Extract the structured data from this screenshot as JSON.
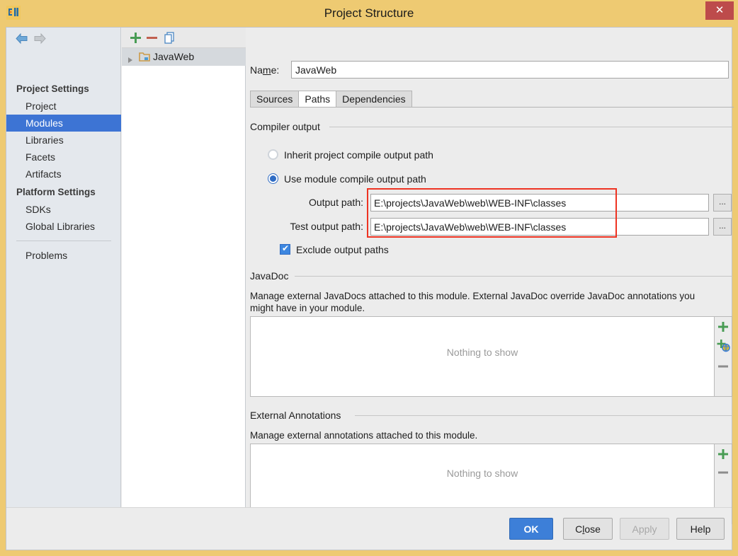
{
  "window": {
    "title": "Project Structure",
    "logo_icon": "intellij-idea-logo",
    "close_icon": "✕",
    "border_color": "#eeca72",
    "close_button_color": "#bd4b4b"
  },
  "sidebar": {
    "back_icon": "arrow-left-icon",
    "forward_icon": "arrow-right-icon",
    "groups": [
      {
        "label": "Project Settings",
        "items": [
          {
            "label": "Project",
            "selected": false
          },
          {
            "label": "Modules",
            "selected": true
          },
          {
            "label": "Libraries",
            "selected": false
          },
          {
            "label": "Facets",
            "selected": false
          },
          {
            "label": "Artifacts",
            "selected": false
          }
        ]
      },
      {
        "label": "Platform Settings",
        "items": [
          {
            "label": "SDKs",
            "selected": false
          },
          {
            "label": "Global Libraries",
            "selected": false
          }
        ]
      }
    ],
    "extra_items": [
      {
        "label": "Problems",
        "selected": false
      }
    ],
    "selection_color": "#3d74d4"
  },
  "tree_panel": {
    "toolbar": {
      "add_icon": "plus-icon",
      "remove_icon": "minus-icon",
      "copy_icon": "copy-icon",
      "add_color": "#4caf50",
      "remove_color": "#cc5543",
      "copy_color": "#3d7fd8"
    },
    "nodes": [
      {
        "label": "JavaWeb",
        "expand_icon": "chevron-right-icon",
        "node_icon": "module-folder-icon",
        "selected": true
      }
    ]
  },
  "main": {
    "name_label": "Name:",
    "name_label_mnemonic": "m",
    "name_value": "JavaWeb",
    "tabs": [
      {
        "label": "Sources",
        "active": false
      },
      {
        "label": "Paths",
        "active": true
      },
      {
        "label": "Dependencies",
        "active": false
      }
    ],
    "compiler_output": {
      "group_label": "Compiler output",
      "radios": [
        {
          "label": "Inherit project compile output path",
          "selected": false
        },
        {
          "label": "Use module compile output path",
          "selected": true
        }
      ],
      "fields": [
        {
          "label": "Output path:",
          "value": "E:\\projects\\JavaWeb\\web\\WEB-INF\\classes",
          "browse_label": "...",
          "browse_icon": "ellipsis-icon"
        },
        {
          "label": "Test output path:",
          "value": "E:\\projects\\JavaWeb\\web\\WEB-INF\\classes",
          "browse_label": "...",
          "browse_icon": "ellipsis-icon"
        }
      ],
      "checkbox": {
        "label": "Exclude output paths",
        "checked": true
      }
    },
    "javadoc": {
      "group_label": "JavaDoc",
      "description": "Manage external JavaDocs attached to this module. External JavaDoc override JavaDoc annotations you might have in your module.",
      "empty_text": "Nothing to show",
      "buttons": [
        {
          "icon": "plus-icon",
          "name": "add"
        },
        {
          "icon": "plus-globe-icon",
          "name": "add-url"
        },
        {
          "icon": "minus-icon",
          "name": "remove"
        }
      ]
    },
    "external_annotations": {
      "group_label": "External Annotations",
      "description": "Manage external annotations attached to this module.",
      "empty_text": "Nothing to show",
      "buttons": [
        {
          "icon": "plus-icon",
          "name": "add"
        },
        {
          "icon": "minus-icon",
          "name": "remove"
        }
      ]
    },
    "annotation_overlay": {
      "color": "#ee3322",
      "shape": "rectangle"
    }
  },
  "footer": {
    "ok_label": "OK",
    "close_label": "Close",
    "close_mnemonic": "l",
    "apply_label": "Apply",
    "apply_enabled": false,
    "help_label": "Help",
    "ok_color": "#3d7fd8"
  }
}
